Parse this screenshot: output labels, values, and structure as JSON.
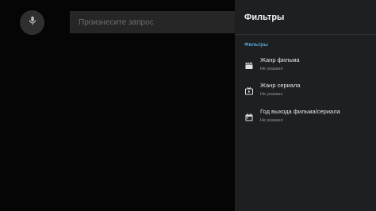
{
  "search": {
    "placeholder": "Произнесите запрос",
    "mic_icon": "microphone-icon"
  },
  "panel": {
    "title": "Фильтры",
    "section_label": "Фильтры",
    "accent_color": "#58a6d8",
    "items": [
      {
        "icon": "movie-clapper-icon",
        "title": "Жанр фильма",
        "value": "Не указано"
      },
      {
        "icon": "tv-play-icon",
        "title": "Жанр сериала",
        "value": "Не указано"
      },
      {
        "icon": "calendar-icon",
        "title": "Год выхода фильма/сериала",
        "value": "Не указано"
      }
    ]
  }
}
